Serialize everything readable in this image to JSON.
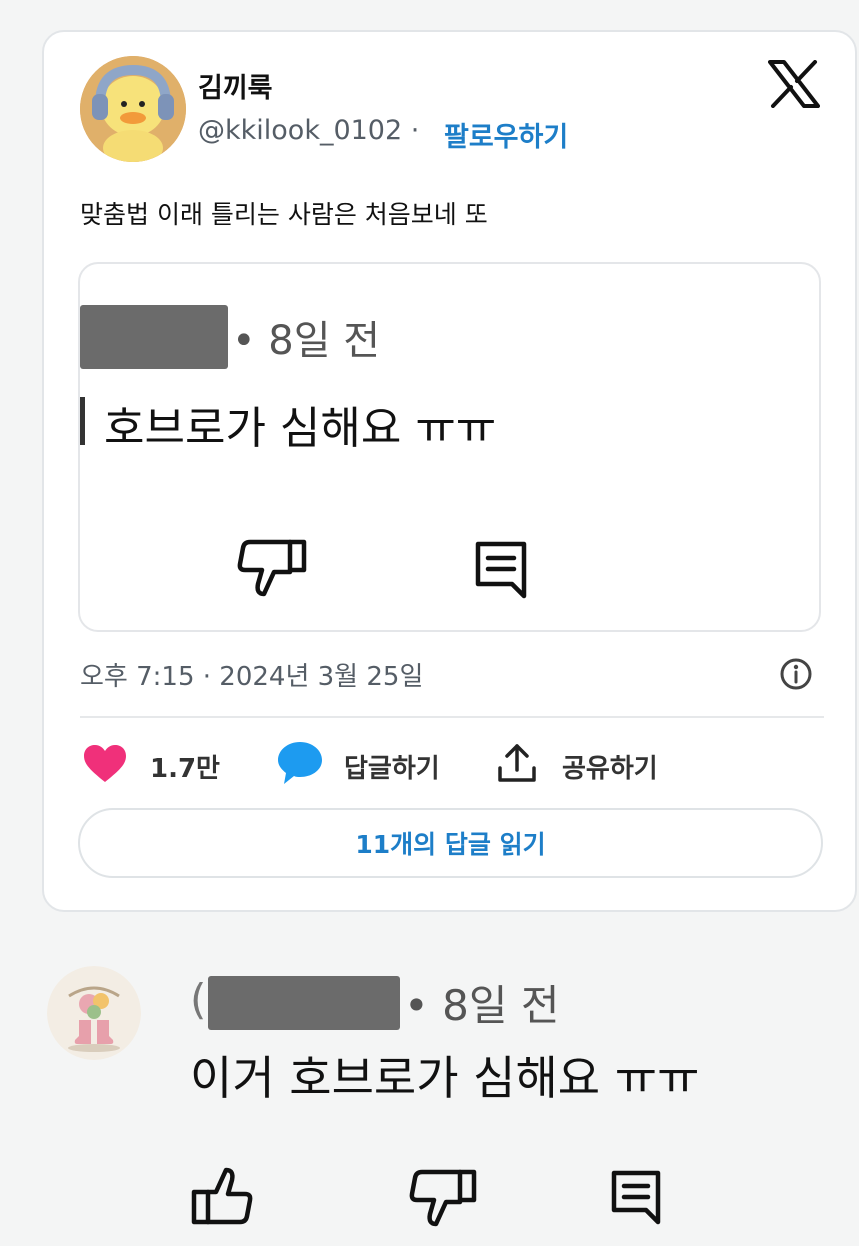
{
  "tweet": {
    "author_name": "김끼룩",
    "author_handle": "@kkilook_0102 · ",
    "follow_label": "팔로우하기",
    "text": "맞춤법 이래 틀리는 사람은 처음보네 또",
    "timestamp": "오후 7:15 · 2024년 3월 25일",
    "like_count": "1.7만",
    "reply_label": "답글하기",
    "share_label": "공유하기",
    "read_replies_label": "11개의 답글 읽기",
    "colors": {
      "link": "#1d7ec8",
      "heart": "#f0307a",
      "reply_bubble": "#1d9bf0"
    }
  },
  "embedded_screenshot": {
    "time_ago": "• 8일 전",
    "comment_text": "호브로가 심해요 ㅠㅠ",
    "icons": [
      "dislike-icon",
      "reply-icon"
    ]
  },
  "comment": {
    "paren": "(",
    "time_ago": "• 8일 전",
    "text": "이거 호브로가 심해요 ㅠㅠ",
    "icons": [
      "like-icon",
      "dislike-icon",
      "reply-icon"
    ]
  }
}
